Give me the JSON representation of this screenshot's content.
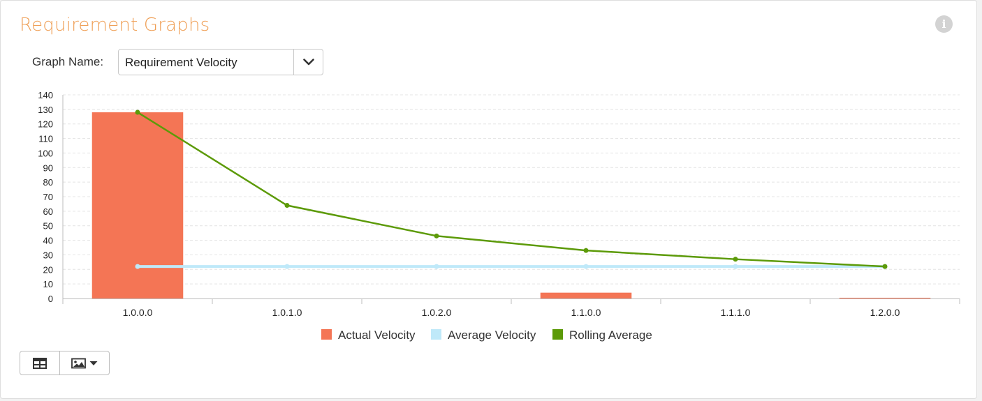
{
  "panel": {
    "title": "Requirement Graphs",
    "info_icon": "info-icon"
  },
  "graph_selector": {
    "label": "Graph Name:",
    "selected": "Requirement Velocity",
    "dropdown_icon": "chevron-down-icon"
  },
  "toolbar": {
    "table_icon": "table-icon",
    "image_icon": "image-icon",
    "caret_icon": "caret-down-icon"
  },
  "colors": {
    "title": "#ef9f56",
    "actual": "#f47555",
    "average": "#bfe9f9",
    "rolling": "#5c9a08"
  },
  "chart_data": {
    "type": "bar",
    "categories": [
      "1.0.0.0",
      "1.0.1.0",
      "1.0.2.0",
      "1.1.0.0",
      "1.1.1.0",
      "1.2.0.0"
    ],
    "ylim": [
      0,
      140
    ],
    "yticks": [
      0,
      10,
      20,
      30,
      40,
      50,
      60,
      70,
      80,
      90,
      100,
      110,
      120,
      130,
      140
    ],
    "grid": true,
    "legend_position": "bottom",
    "series": [
      {
        "name": "Actual Velocity",
        "type": "bar",
        "color": "#f47555",
        "values": [
          128,
          0,
          0,
          4,
          0,
          0.5
        ]
      },
      {
        "name": "Average Velocity",
        "type": "line",
        "color": "#bfe9f9",
        "values": [
          22,
          22,
          22,
          22,
          22,
          22
        ]
      },
      {
        "name": "Rolling Average",
        "type": "line",
        "color": "#5c9a08",
        "values": [
          128,
          64,
          43,
          33,
          27,
          22
        ]
      }
    ]
  }
}
